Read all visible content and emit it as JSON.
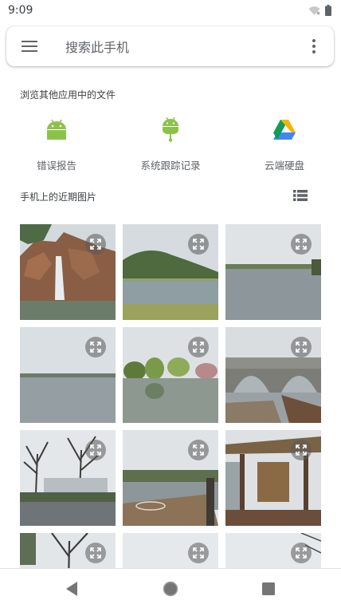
{
  "status_bar": {
    "time": "9:09",
    "icons": [
      "wifi-off-icon",
      "battery-icon"
    ]
  },
  "search": {
    "placeholder": "搜索此手机",
    "menu_icon": "hamburger-menu-icon",
    "more_icon": "more-vert-icon"
  },
  "browse_section": {
    "title": "浏览其他应用中的文件",
    "apps": [
      {
        "label": "错误报告",
        "icon": "android-icon",
        "color": "#8bc34a"
      },
      {
        "label": "系统跟踪记录",
        "icon": "android-pin-icon",
        "color": "#8bc34a"
      },
      {
        "label": "云端硬盘",
        "icon": "google-drive-icon",
        "colors": [
          "#0f9d58",
          "#f4b400",
          "#4285f4"
        ]
      }
    ]
  },
  "recent_section": {
    "title": "手机上的近期图片",
    "view_toggle_icon": "list-view-icon"
  },
  "photos": [
    {
      "scene": "rock-waterfall"
    },
    {
      "scene": "hill-lake"
    },
    {
      "scene": "lake-horizon"
    },
    {
      "scene": "gray-lake"
    },
    {
      "scene": "trees-reflection"
    },
    {
      "scene": "stone-bridge"
    },
    {
      "scene": "bare-trees-building"
    },
    {
      "scene": "wooden-dock"
    },
    {
      "scene": "thatched-pavilion"
    },
    {
      "scene": "bare-tree-partial"
    },
    {
      "scene": "sky-partial"
    },
    {
      "scene": "branches-partial"
    }
  ],
  "photo_overlay_icon": "expand-icon",
  "nav_bar": {
    "buttons": [
      "back-icon",
      "home-icon",
      "recents-icon"
    ]
  }
}
